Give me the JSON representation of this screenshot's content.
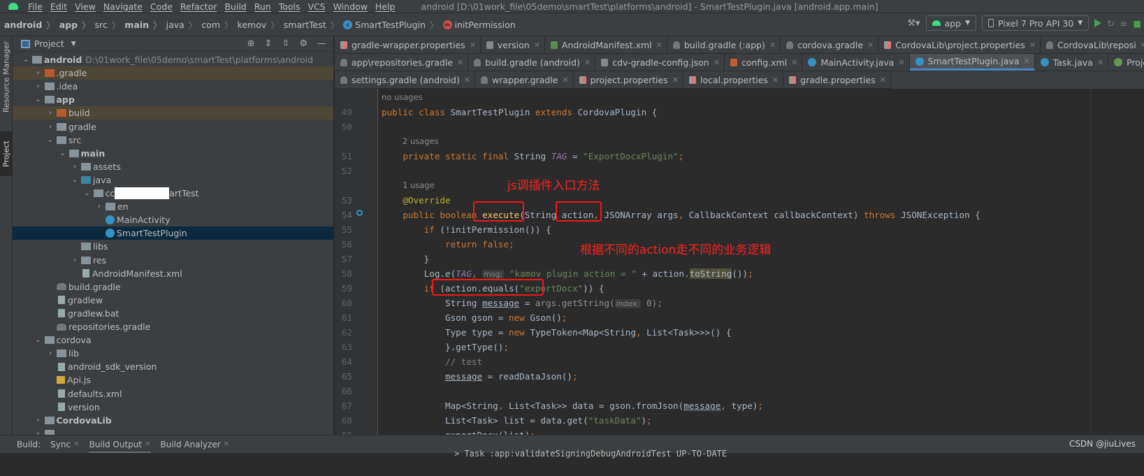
{
  "menubar": {
    "items": [
      "File",
      "Edit",
      "View",
      "Navigate",
      "Code",
      "Refactor",
      "Build",
      "Run",
      "Tools",
      "VCS",
      "Window",
      "Help"
    ],
    "window_title": "android [D:\\01work_file\\05demo\\smartTest\\platforms\\android] - SmartTestPlugin.java [android.app.main]"
  },
  "breadcrumb": [
    {
      "label": "android",
      "bold": true
    },
    {
      "label": "app",
      "bold": true
    },
    {
      "label": "src"
    },
    {
      "label": "main",
      "bold": true
    },
    {
      "label": "java"
    },
    {
      "label": "com"
    },
    {
      "label": "kemov"
    },
    {
      "label": "smartTest"
    },
    {
      "label": "SmartTestPlugin",
      "icon": "class-icon"
    },
    {
      "label": "initPermission",
      "icon": "method-icon"
    }
  ],
  "run_toolbar": {
    "config": "app",
    "device": "Pixel 7 Pro API 30"
  },
  "side_tabs": {
    "resource_manager": "Resource Manager",
    "project": "Project"
  },
  "project_panel": {
    "title": "Project"
  },
  "tree": [
    {
      "depth": 0,
      "arrow": "down",
      "icon": "module",
      "name": "android",
      "bold": true,
      "path": "D:\\01work_file\\05demo\\smartTest\\platforms\\android"
    },
    {
      "depth": 1,
      "arrow": "right",
      "icon": "orange",
      "name": ".gradle",
      "state": "hl"
    },
    {
      "depth": 1,
      "arrow": "right",
      "icon": "folder",
      "name": ".idea"
    },
    {
      "depth": 1,
      "arrow": "down",
      "icon": "module",
      "name": "app",
      "bold": true
    },
    {
      "depth": 2,
      "arrow": "right",
      "icon": "orange",
      "name": "build",
      "state": "hl"
    },
    {
      "depth": 2,
      "arrow": "right",
      "icon": "folder",
      "name": "gradle"
    },
    {
      "depth": 2,
      "arrow": "down",
      "icon": "folder",
      "name": "src"
    },
    {
      "depth": 3,
      "arrow": "down",
      "icon": "module",
      "name": "main",
      "bold": true
    },
    {
      "depth": 4,
      "arrow": "right",
      "icon": "folder",
      "name": "assets"
    },
    {
      "depth": 4,
      "arrow": "down",
      "icon": "blue",
      "name": "java"
    },
    {
      "depth": 5,
      "arrow": "down",
      "icon": "folder",
      "name": "cc",
      "name_after": "artTest",
      "redacted": true
    },
    {
      "depth": 6,
      "arrow": "right",
      "icon": "folder",
      "name": "en"
    },
    {
      "depth": 6,
      "arrow": "",
      "icon": "class",
      "name": "MainActivity"
    },
    {
      "depth": 6,
      "arrow": "",
      "icon": "class",
      "name": "SmartTestPlugin",
      "state": "sel"
    },
    {
      "depth": 4,
      "arrow": "",
      "icon": "folder",
      "name": "libs"
    },
    {
      "depth": 4,
      "arrow": "right",
      "icon": "folder",
      "name": "res"
    },
    {
      "depth": 4,
      "arrow": "",
      "icon": "file",
      "name": "AndroidManifest.xml"
    },
    {
      "depth": 2,
      "arrow": "",
      "icon": "gradle",
      "name": "build.gradle"
    },
    {
      "depth": 2,
      "arrow": "",
      "icon": "file",
      "name": "gradlew"
    },
    {
      "depth": 2,
      "arrow": "",
      "icon": "file",
      "name": "gradlew.bat"
    },
    {
      "depth": 2,
      "arrow": "",
      "icon": "gradle",
      "name": "repositories.gradle"
    },
    {
      "depth": 1,
      "arrow": "down",
      "icon": "folder",
      "name": "cordova"
    },
    {
      "depth": 2,
      "arrow": "right",
      "icon": "folder",
      "name": "lib"
    },
    {
      "depth": 2,
      "arrow": "",
      "icon": "file",
      "name": "android_sdk_version"
    },
    {
      "depth": 2,
      "arrow": "",
      "icon": "js",
      "name": "Api.js"
    },
    {
      "depth": 2,
      "arrow": "",
      "icon": "file",
      "name": "defaults.xml"
    },
    {
      "depth": 2,
      "arrow": "",
      "icon": "file",
      "name": "version"
    },
    {
      "depth": 1,
      "arrow": "right",
      "icon": "module",
      "name": "CordovaLib",
      "bold": true
    },
    {
      "depth": 1,
      "arrow": "right",
      "icon": "folder",
      "name": ""
    }
  ],
  "editor_tabs": [
    [
      {
        "label": "gradle-wrapper.properties",
        "icon": "prop"
      },
      {
        "label": "version",
        "icon": "file"
      },
      {
        "label": "AndroidManifest.xml",
        "icon": "mf"
      },
      {
        "label": "build.gradle (:app)",
        "icon": "gr"
      },
      {
        "label": "cordova.gradle",
        "icon": "gr"
      },
      {
        "label": "CordovaLib\\project.properties",
        "icon": "prop"
      },
      {
        "label": "CordovaLib\\reposi",
        "icon": "gr"
      }
    ],
    [
      {
        "label": "app\\repositories.gradle",
        "icon": "gr"
      },
      {
        "label": "build.gradle (android)",
        "icon": "gr"
      },
      {
        "label": "cdv-gradle-config.json",
        "icon": "file"
      },
      {
        "label": "config.xml",
        "icon": "xml"
      },
      {
        "label": "MainActivity.java",
        "icon": "java"
      },
      {
        "label": "SmartTestPlugin.java",
        "icon": "java",
        "active": true
      },
      {
        "label": "Task.java",
        "icon": "java"
      },
      {
        "label": "Proje",
        "icon": "iface"
      }
    ],
    [
      {
        "label": "settings.gradle (android)",
        "icon": "gr"
      },
      {
        "label": "wrapper.gradle",
        "icon": "gr"
      },
      {
        "label": "project.properties",
        "icon": "prop"
      },
      {
        "label": "local.properties",
        "icon": "prop"
      },
      {
        "label": "gradle.properties",
        "icon": "prop"
      }
    ]
  ],
  "code": [
    {
      "usage": "no usages",
      "indent": 0
    },
    {
      "n": "49",
      "t": [
        [
          "public class ",
          "kw"
        ],
        [
          "SmartTestPlugin ",
          ""
        ],
        [
          "extends ",
          "kw"
        ],
        [
          "CordovaPlugin {",
          ""
        ]
      ]
    },
    {
      "n": "50",
      "t": []
    },
    {
      "usage": "2 usages",
      "indent": 1
    },
    {
      "n": "51",
      "t": [
        [
          "    private static final ",
          "kw"
        ],
        [
          "String ",
          ""
        ],
        [
          "TAG",
          "tag"
        ],
        [
          " = ",
          ""
        ],
        [
          "\"ExportDocxPlugin\"",
          "str"
        ],
        [
          ";",
          "kw"
        ]
      ]
    },
    {
      "n": "52",
      "t": []
    },
    {
      "usage": "1 usage",
      "indent": 1
    },
    {
      "n": "53",
      "t": [
        [
          "    @Override",
          "ann"
        ]
      ]
    },
    {
      "n": "54",
      "t": [
        [
          "    public boolean ",
          "kw"
        ],
        [
          "execute",
          "fn"
        ],
        [
          "(String action",
          ""
        ],
        [
          ", ",
          "kw"
        ],
        [
          "JSONArray args",
          ""
        ],
        [
          ", ",
          "kw"
        ],
        [
          "CallbackContext callbackContext) ",
          ""
        ],
        [
          "throws ",
          "kw"
        ],
        [
          "JSONException {",
          ""
        ]
      ]
    },
    {
      "n": "55",
      "t": [
        [
          "        if ",
          "kw"
        ],
        [
          "(!initPermission()) {",
          ""
        ]
      ]
    },
    {
      "n": "56",
      "t": [
        [
          "            return false",
          "kw"
        ],
        [
          ";",
          "kw"
        ]
      ]
    },
    {
      "n": "57",
      "t": [
        [
          "        }",
          ""
        ]
      ]
    },
    {
      "n": "58",
      "t": [
        [
          "        Log.",
          ""
        ],
        [
          "e",
          "it"
        ],
        [
          "(",
          ""
        ],
        [
          "TAG",
          "tag"
        ],
        [
          ", ",
          "kw"
        ],
        [
          "msg:",
          "hint"
        ],
        [
          " \"kamov plugin action = \"",
          "str"
        ],
        [
          " + action.",
          ""
        ],
        [
          "toString",
          "hlbg"
        ],
        [
          "())",
          ""
        ],
        [
          ";",
          "kw"
        ]
      ]
    },
    {
      "n": "59",
      "t": [
        [
          "        if ",
          "kw"
        ],
        [
          "(action.equals(",
          ""
        ],
        [
          "\"exportDocx\"",
          "str"
        ],
        [
          ")) {",
          ""
        ]
      ]
    },
    {
      "n": "60",
      "t": [
        [
          "            String ",
          ""
        ],
        [
          "message",
          "ul"
        ],
        [
          " = ",
          ""
        ],
        [
          "args.getString(",
          "dim"
        ],
        [
          "index:",
          "hint"
        ],
        [
          " 0)",
          "dim"
        ],
        [
          ";",
          "kw"
        ]
      ]
    },
    {
      "n": "61",
      "t": [
        [
          "            Gson gson = ",
          ""
        ],
        [
          "new ",
          "kw"
        ],
        [
          "Gson()",
          ""
        ],
        [
          ";",
          "kw"
        ]
      ]
    },
    {
      "n": "62",
      "t": [
        [
          "            Type type = ",
          ""
        ],
        [
          "new ",
          "kw"
        ],
        [
          "TypeToken<Map<String",
          ""
        ],
        [
          ", ",
          "kw"
        ],
        [
          "List<Task>>>() {",
          ""
        ]
      ]
    },
    {
      "n": "63",
      "t": [
        [
          "            }.getType()",
          ""
        ],
        [
          ";",
          "kw"
        ]
      ]
    },
    {
      "n": "64",
      "t": [
        [
          "            // test",
          "cm"
        ]
      ]
    },
    {
      "n": "65",
      "t": [
        [
          "            ",
          ""
        ],
        [
          "message",
          "ul"
        ],
        [
          " = readDataJson()",
          ""
        ],
        [
          ";",
          "kw"
        ]
      ]
    },
    {
      "n": "66",
      "t": []
    },
    {
      "n": "67",
      "t": [
        [
          "            Map<String",
          ""
        ],
        [
          ", ",
          "kw"
        ],
        [
          "List<Task>> data = gson.fromJson(",
          ""
        ],
        [
          "message",
          "ul"
        ],
        [
          ", ",
          "kw"
        ],
        [
          "type)",
          ""
        ],
        [
          ";",
          "kw"
        ]
      ]
    },
    {
      "n": "68",
      "t": [
        [
          "            List<Task> list = data.get(",
          ""
        ],
        [
          "\"taskData\"",
          "str"
        ],
        [
          ")",
          ""
        ],
        [
          ";",
          "kw"
        ]
      ]
    },
    {
      "n": "69",
      "t": [
        [
          "            exportDocx(list)",
          ""
        ],
        [
          ";",
          "kw"
        ]
      ]
    }
  ],
  "annotations": {
    "note1": "js调插件入口方法",
    "note2": "根据不同的action走不同的业务逻辑",
    "color": "#f21818"
  },
  "build_bar": {
    "label": "Build:",
    "tabs": [
      "Sync",
      "Build Output",
      "Build Analyzer"
    ],
    "active": "Build Output"
  },
  "build_output_line": "> Task :app:validateSigningDebugAndroidTest UP-TO-DATE",
  "watermark": "CSDN @jiuLives",
  "colors": {
    "keyword": "#cc7832",
    "string": "#6a8759",
    "annotation": "#bbb529",
    "field": "#9876aa",
    "method_decl": "#ffc66d",
    "plain": "#a9b7c6",
    "selection": "#0d293e",
    "accent_tab": "#4a88c7"
  }
}
